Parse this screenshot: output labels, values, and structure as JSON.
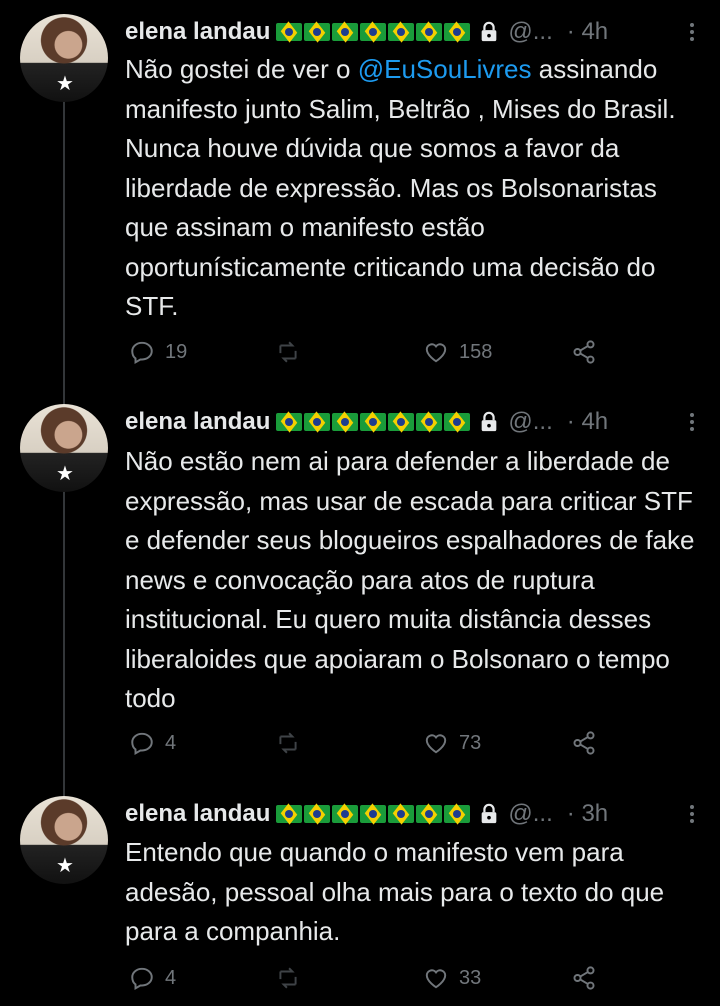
{
  "tweets": [
    {
      "name": "elena landau",
      "handle": "@...",
      "time": "4h",
      "text_pre": "Não gostei de ver o ",
      "mention": "@EuSouLivres",
      "text_post": " assinando manifesto junto Salim, Beltrão , Mises do Brasil. Nunca houve  dúvida que somos a favor da liberdade de expressão. Mas os Bolsonaristas que assinam o manifesto estão oportunísticamente criticando uma decisão do STF.",
      "replies": "19",
      "retweets": "",
      "likes": "158"
    },
    {
      "name": "elena landau",
      "handle": "@...",
      "time": "4h",
      "text_pre": "Não estão nem ai para defender a liberdade de expressão, mas usar de escada para criticar STF e defender seus blogueiros espalhadores de fake news e convocação para atos de ruptura institucional. Eu quero muita distância desses liberaloides que apoiaram o Bolsonaro o tempo todo",
      "mention": "",
      "text_post": "",
      "replies": "4",
      "retweets": "",
      "likes": "73"
    },
    {
      "name": "elena landau",
      "handle": "@...",
      "time": "3h",
      "text_pre": "Entendo que quando o manifesto vem para adesão, pessoal olha mais para o texto do que para a companhia.",
      "mention": "",
      "text_post": "",
      "replies": "4",
      "retweets": "",
      "likes": "33"
    }
  ],
  "icons": {
    "avatar_badge": "star-icon",
    "verified_flags": "brazil-flag-icon",
    "protected": "lock-icon",
    "more": "more-icon",
    "reply": "reply-icon",
    "retweet": "retweet-icon",
    "like": "heart-icon",
    "share": "share-icon"
  },
  "colors": {
    "background": "#000000",
    "text": "#e7e9ea",
    "secondary": "#71767b",
    "link": "#1d9bf0"
  }
}
